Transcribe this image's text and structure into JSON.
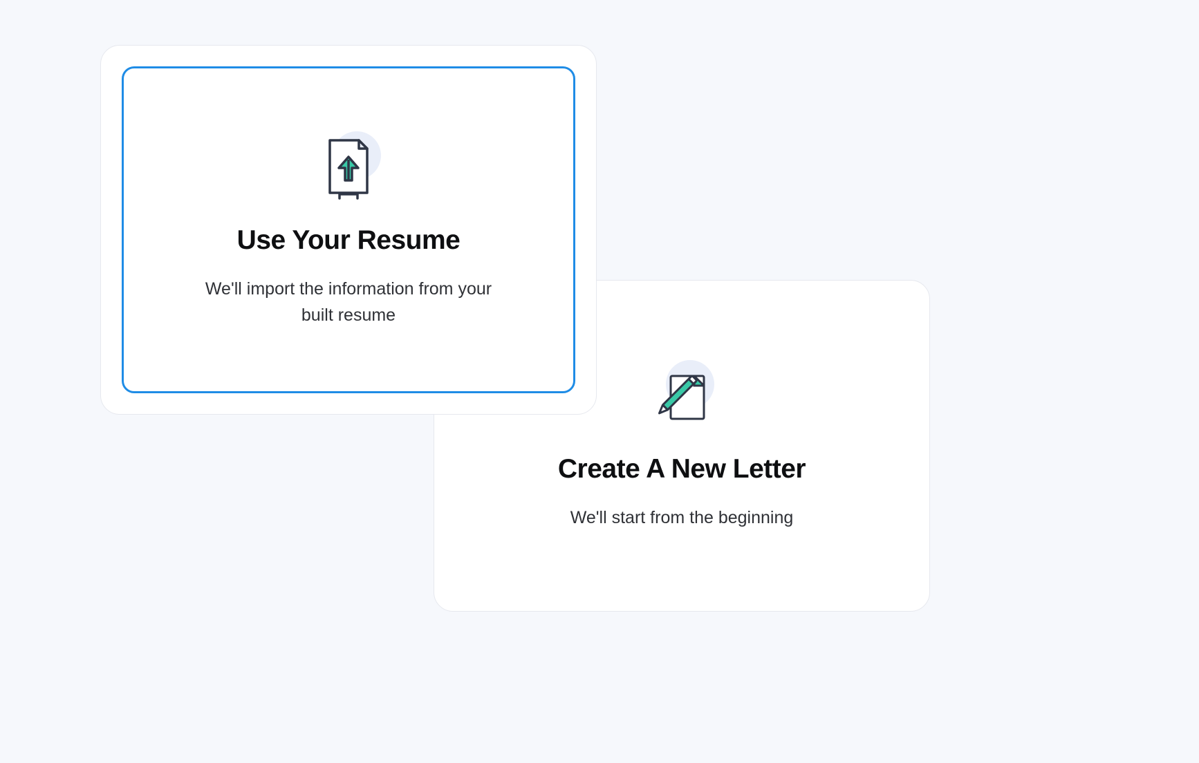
{
  "options": {
    "use_resume": {
      "title": "Use Your Resume",
      "subtitle": "We'll import the information from your built resume"
    },
    "new_letter": {
      "title": "Create A New Letter",
      "subtitle": "We'll start  from the beginning"
    }
  },
  "colors": {
    "accent": "#1f8ce6",
    "icon_accent": "#39c9a7",
    "icon_stroke": "#2f3646"
  }
}
